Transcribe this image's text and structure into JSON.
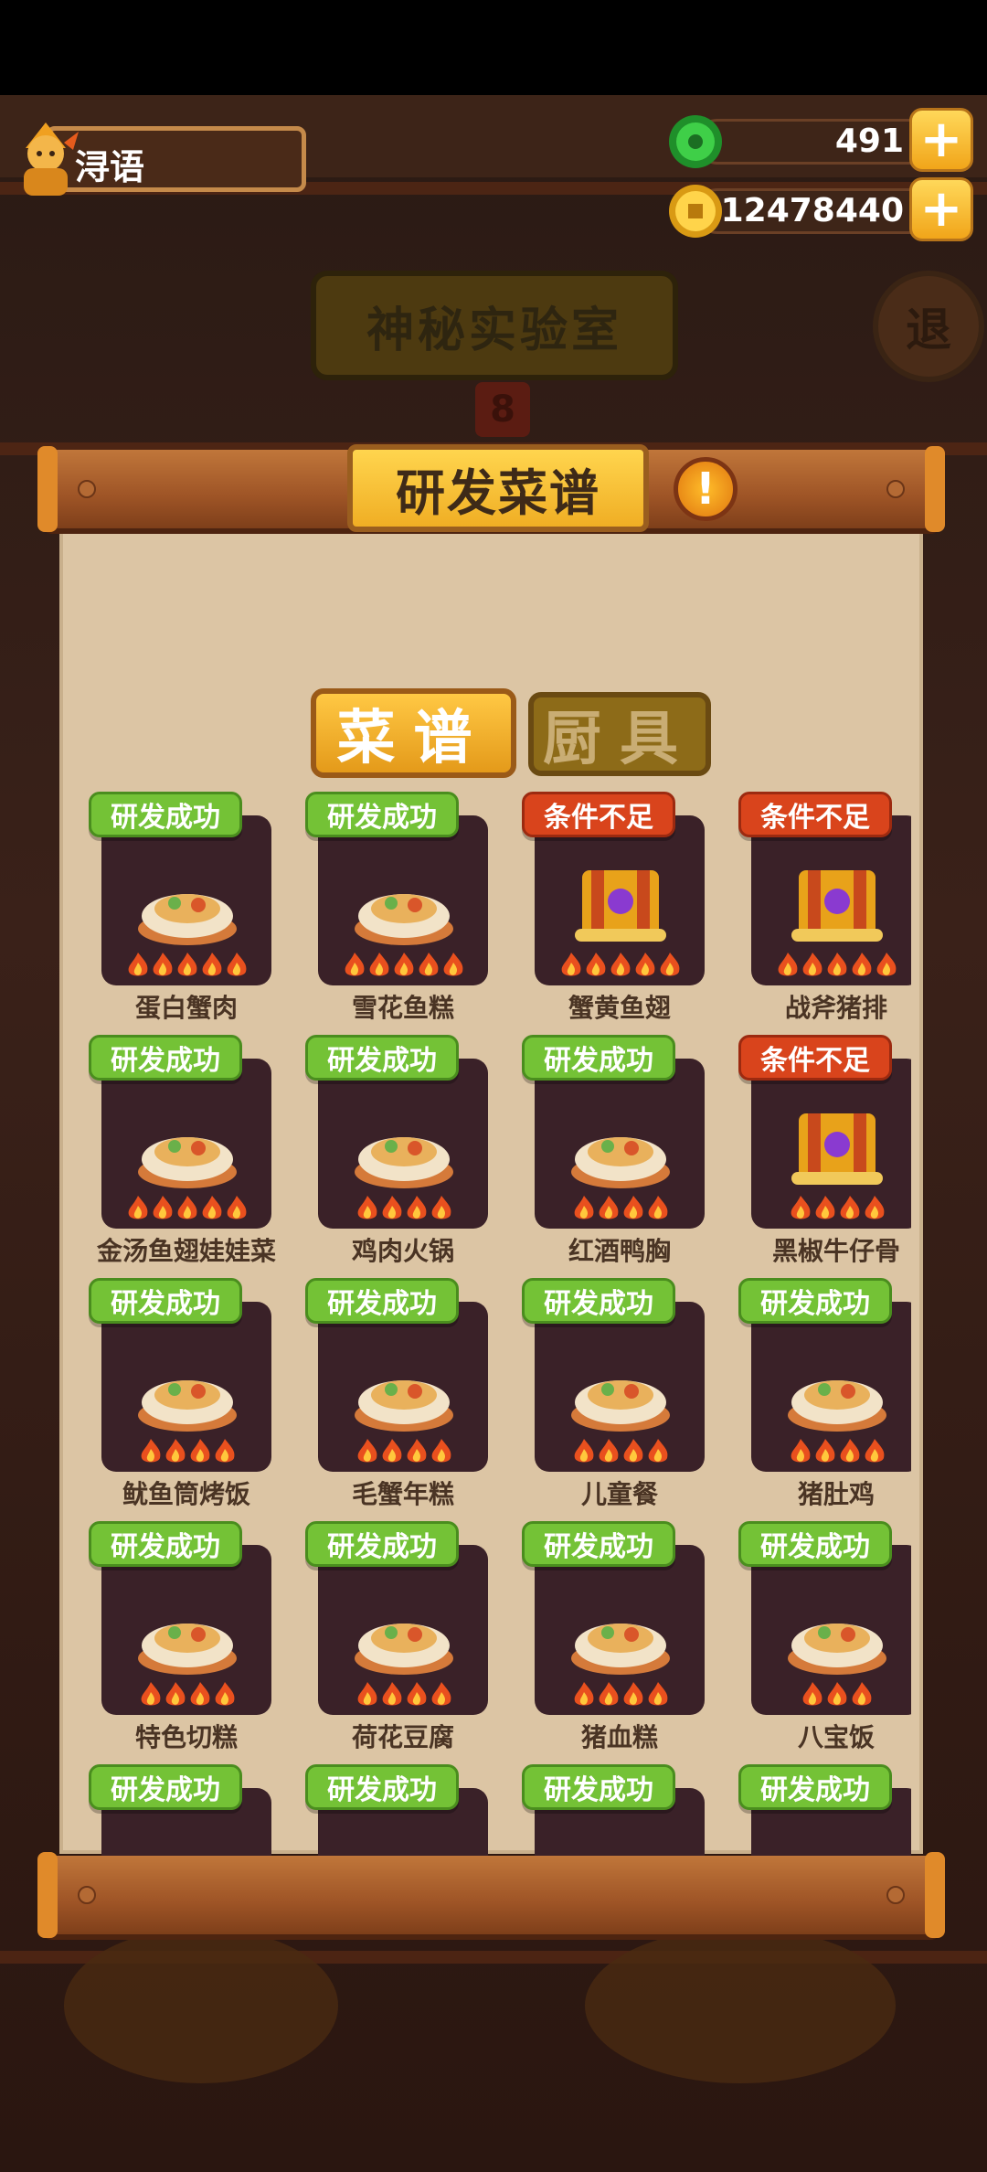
{
  "player": {
    "name": "浔语"
  },
  "resources": {
    "jade": "491",
    "coins": "12478440",
    "plus_symbol": "+"
  },
  "background": {
    "lab_title": "神秘实验室",
    "exit_label": "退",
    "sign_label": "8"
  },
  "panel": {
    "title": "研发菜谱",
    "info_symbol": "!"
  },
  "tabs": {
    "recipes": "菜谱",
    "utensils": "厨具"
  },
  "status_labels": {
    "success": "研发成功",
    "insufficient": "条件不足"
  },
  "colors": {
    "success": "#74c236",
    "insufficient": "#d9441c",
    "paper": "#dcc5a4",
    "slot": "#3a2128"
  },
  "recipes": [
    {
      "name": "蛋白蟹肉",
      "status": "研发成功",
      "flames": 5
    },
    {
      "name": "雪花鱼糕",
      "status": "研发成功",
      "flames": 5
    },
    {
      "name": "蟹黄鱼翅",
      "status": "条件不足",
      "flames": 5
    },
    {
      "name": "战斧猪排",
      "status": "条件不足",
      "flames": 5
    },
    {
      "name": "金汤鱼翅娃娃菜",
      "status": "研发成功",
      "flames": 5
    },
    {
      "name": "鸡肉火锅",
      "status": "研发成功",
      "flames": 4
    },
    {
      "name": "红酒鸭胸",
      "status": "研发成功",
      "flames": 4
    },
    {
      "name": "黑椒牛仔骨",
      "status": "条件不足",
      "flames": 4
    },
    {
      "name": "鱿鱼筒烤饭",
      "status": "研发成功",
      "flames": 4
    },
    {
      "name": "毛蟹年糕",
      "status": "研发成功",
      "flames": 4
    },
    {
      "name": "儿童餐",
      "status": "研发成功",
      "flames": 4
    },
    {
      "name": "猪肚鸡",
      "status": "研发成功",
      "flames": 4
    },
    {
      "name": "特色切糕",
      "status": "研发成功",
      "flames": 4
    },
    {
      "name": "荷花豆腐",
      "status": "研发成功",
      "flames": 4
    },
    {
      "name": "猪血糕",
      "status": "研发成功",
      "flames": 4
    },
    {
      "name": "八宝饭",
      "status": "研发成功",
      "flames": 3
    },
    {
      "name": "",
      "status": "研发成功",
      "flames": 0
    },
    {
      "name": "",
      "status": "研发成功",
      "flames": 0
    },
    {
      "name": "",
      "status": "研发成功",
      "flames": 0
    },
    {
      "name": "",
      "status": "研发成功",
      "flames": 0
    }
  ],
  "dish_icons": [
    "crab-meat-bowl-icon",
    "fish-cake-pot-icon",
    "locked-scroll-icon",
    "locked-scroll-icon",
    "shark-fin-pot-icon",
    "chicken-hotpot-icon",
    "duck-breast-plate-icon",
    "locked-scroll-icon",
    "squid-rice-plate-icon",
    "crab-ricecake-bowl-icon",
    "kids-meal-bowl-icon",
    "pork-chicken-pot-icon",
    "cut-cake-icon",
    "lotus-tofu-bowl-icon",
    "blood-cake-plate-icon",
    "eight-treasure-rice-icon",
    "dish-icon",
    "dish-icon",
    "dish-icon",
    "dish-icon"
  ]
}
